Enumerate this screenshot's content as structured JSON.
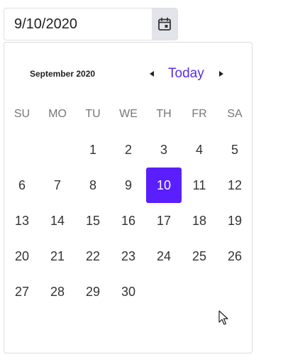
{
  "date_input": {
    "value": "9/10/2020",
    "icon": "calendar-icon"
  },
  "calendar": {
    "month_title": "September 2020",
    "today_label": "Today",
    "prev_icon": "triangle-left-icon",
    "next_icon": "triangle-right-icon",
    "weekdays": [
      "SU",
      "MO",
      "TU",
      "WE",
      "TH",
      "FR",
      "SA"
    ],
    "weeks": [
      [
        "",
        "",
        "1",
        "2",
        "3",
        "4",
        "5"
      ],
      [
        "6",
        "7",
        "8",
        "9",
        "10",
        "11",
        "12"
      ],
      [
        "13",
        "14",
        "15",
        "16",
        "17",
        "18",
        "19"
      ],
      [
        "20",
        "21",
        "22",
        "23",
        "24",
        "25",
        "26"
      ],
      [
        "27",
        "28",
        "29",
        "30",
        "",
        "",
        ""
      ]
    ],
    "selected_day": "10",
    "accent_color": "#5a1fff"
  }
}
